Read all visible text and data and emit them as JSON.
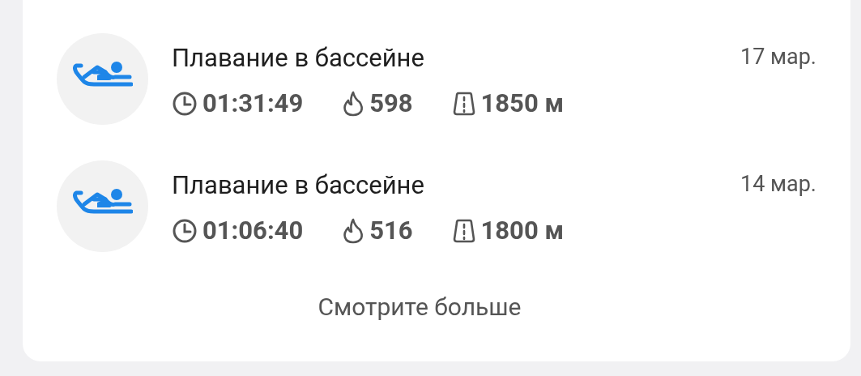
{
  "workouts": [
    {
      "title": "Плавание в бассейне",
      "date": "17 мар.",
      "duration": "01:31:49",
      "calories": "598",
      "distance": "1850 м"
    },
    {
      "title": "Плавание в бассейне",
      "date": "14 мар.",
      "duration": "01:06:40",
      "calories": "516",
      "distance": "1800 м"
    }
  ],
  "more_link": "Смотрите больше"
}
